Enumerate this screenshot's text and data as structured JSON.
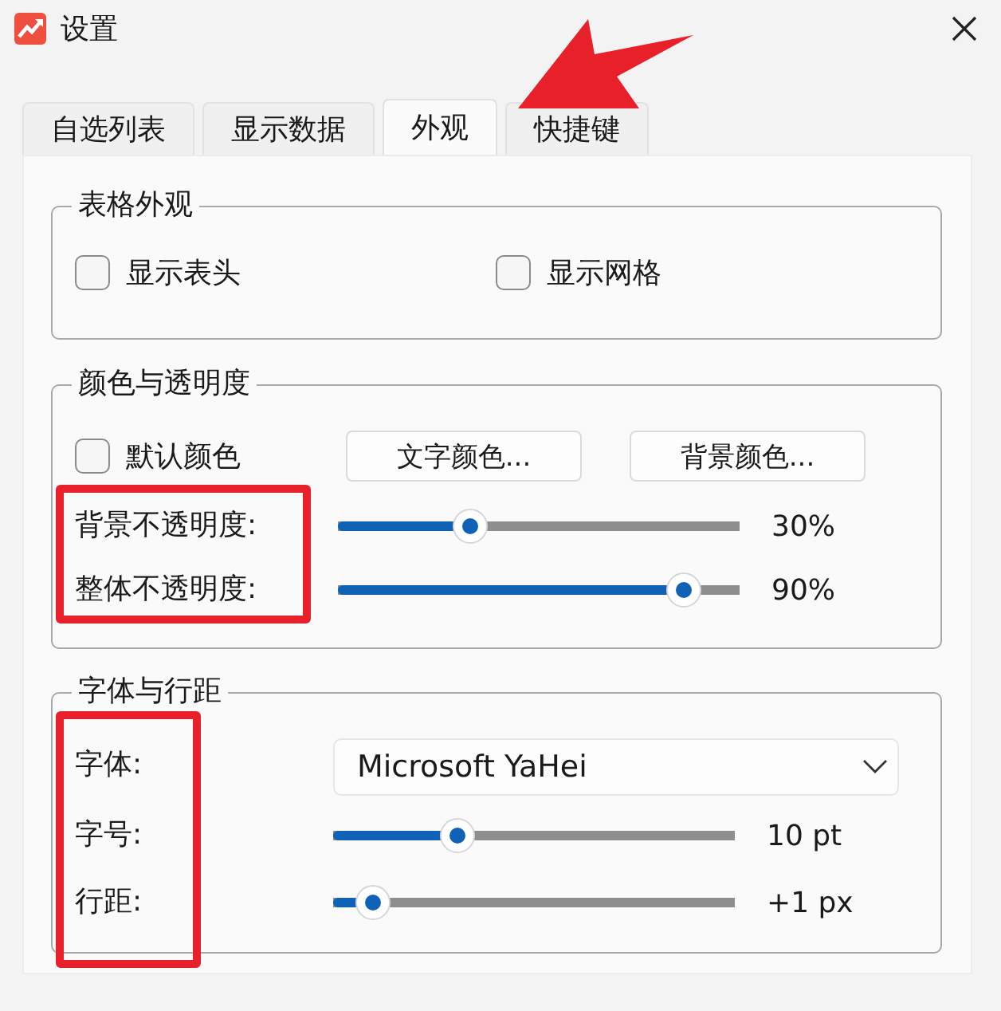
{
  "window": {
    "title": "设置"
  },
  "tabs": [
    {
      "label": "自选列表",
      "selected": false
    },
    {
      "label": "显示数据",
      "selected": false
    },
    {
      "label": "外观",
      "selected": true
    },
    {
      "label": "快捷键",
      "selected": false
    }
  ],
  "groups": [
    {
      "title": "表格外观",
      "rows": [
        {
          "kind": "checks",
          "items": [
            {
              "label": "显示表头",
              "checked": false
            },
            {
              "label": "显示网格",
              "checked": false
            }
          ]
        }
      ]
    },
    {
      "title": "颜色与透明度",
      "rows": [
        {
          "kind": "check_buttons",
          "check": {
            "label": "默认颜色",
            "checked": false
          },
          "buttons": [
            "文字颜色...",
            "背景颜色..."
          ]
        },
        {
          "kind": "slider",
          "label": "背景不透明度:",
          "level": 0.33,
          "reading": "30%"
        },
        {
          "kind": "slider",
          "label": "整体不透明度:",
          "level": 0.86,
          "reading": "90%"
        }
      ]
    },
    {
      "title": "字体与行距",
      "rows": [
        {
          "kind": "dropdown",
          "label": "字体:",
          "value": "Microsoft YaHei"
        },
        {
          "kind": "slider",
          "label": "字号:",
          "level": 0.31,
          "reading": "10 pt"
        },
        {
          "kind": "slider",
          "label": "行距:",
          "level": 0.1,
          "reading": "+1 px"
        }
      ]
    }
  ]
}
